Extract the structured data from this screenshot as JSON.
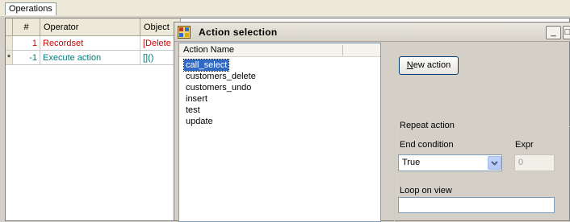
{
  "tabs": [
    {
      "label": "Operations"
    }
  ],
  "grid": {
    "columns": [
      "#",
      "Operator",
      "Object"
    ],
    "rows": [
      {
        "marker": "",
        "num": "1",
        "operator": "Recordset",
        "object": "[Delete r"
      },
      {
        "marker": "*",
        "num": "-1",
        "operator": "Execute action",
        "object": "[]()"
      }
    ]
  },
  "dialog": {
    "title": "Action selection",
    "window_buttons": {
      "minimize": "_",
      "maximize": "□"
    },
    "list": {
      "header": "Action Name",
      "items": [
        "call_select",
        "customers_delete",
        "customers_undo",
        "insert",
        "test",
        "update"
      ],
      "selected_index": 0
    },
    "new_action_button": {
      "accel": "N",
      "rest": "ew action"
    },
    "repeat": {
      "title": "Repeat action",
      "end_condition_label": "End condition",
      "end_condition_value": "True",
      "expr_label": "Expr",
      "expr_value": "0",
      "loop_label": "Loop on view",
      "loop_value": ""
    }
  },
  "colors": {
    "selection": "#316ac5",
    "error_text": "#d40000",
    "new_row_text": "#007a7a"
  }
}
